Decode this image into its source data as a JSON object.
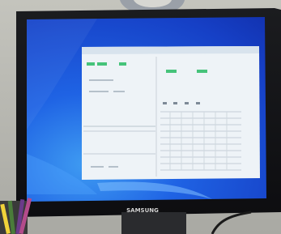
{
  "monitor": {
    "brand": "SAMSUNG"
  },
  "desktop": {
    "background_color": "#1a55d8"
  }
}
